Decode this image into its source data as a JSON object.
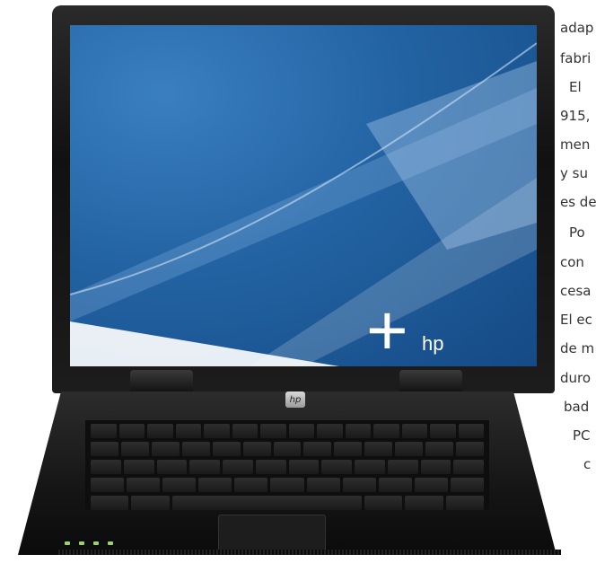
{
  "screen": {
    "brand_plus": "+",
    "brand_text": "hp"
  },
  "lid_logo": "hp",
  "side_text": [
    "adap",
    "fabri",
    "El",
    "915,",
    "men",
    "y su",
    "es de",
    "Po",
    "con",
    "cesa",
    "El ec",
    "de m",
    "duro",
    "bad",
    "PC",
    "c"
  ],
  "colors": {
    "screen_blue": "#2363a3",
    "laptop_black": "#151515",
    "led_green": "#9bd36a"
  }
}
